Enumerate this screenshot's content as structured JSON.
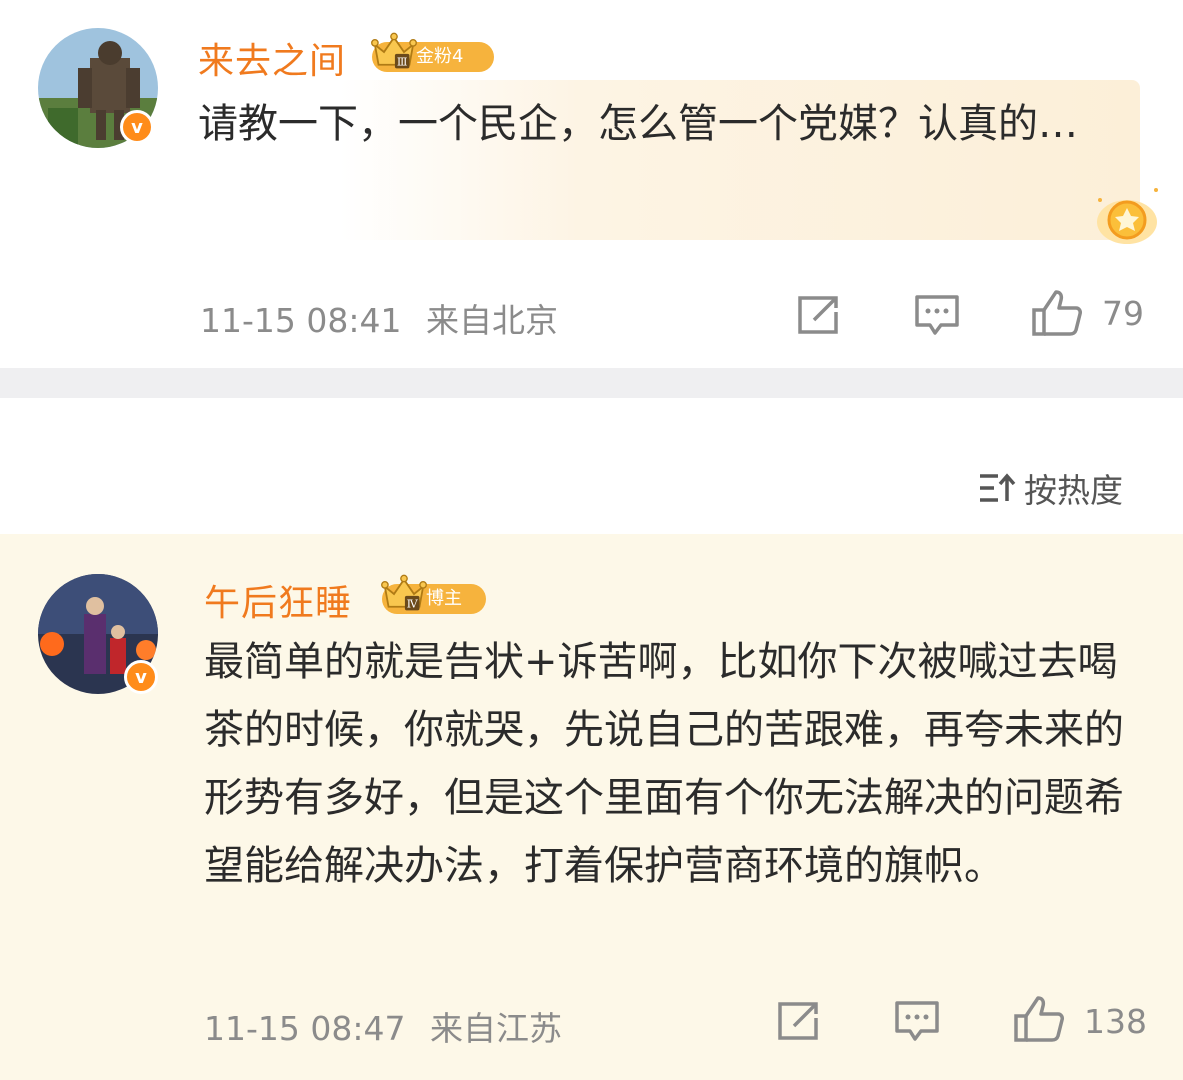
{
  "comments": [
    {
      "username": "来去之间",
      "badge": "金粉4",
      "badge_level": "Ⅲ",
      "text": "请教一下，一个民企，怎么管一个党媒？认真的…",
      "time": "11-15 08:41",
      "location": "来自北京",
      "likes": "79",
      "verified_mark": "v"
    },
    {
      "username": "午后狂睡",
      "badge": "博主",
      "badge_level": "Ⅳ",
      "text": "最简单的就是告状+诉苦啊，比如你下次被喊过去喝茶的时候，你就哭，先说自己的苦跟难，再夸未来的形势有多好，但是这个里面有个你无法解决的问题希望能给解决办法，打着保护营商环境的旗帜。",
      "time": "11-15 08:47",
      "location": "来自江苏",
      "likes": "138",
      "verified_mark": "v"
    }
  ],
  "sort": {
    "label": "按热度"
  },
  "colors": {
    "username": "#f07a1e",
    "badge": "#f6b33d",
    "verified": "#ff8c1a",
    "post2_bg": "#fdf8e8",
    "divider": "#efeff1"
  },
  "icons": [
    "share-icon",
    "comment-icon",
    "like-icon",
    "sort-icon",
    "crown-icon",
    "verified-icon"
  ]
}
